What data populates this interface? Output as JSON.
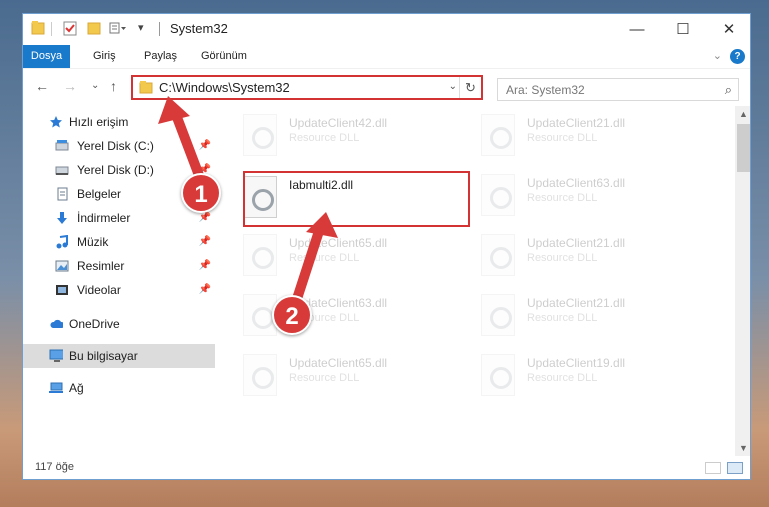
{
  "titlebar": {
    "title": "System32",
    "minimize_glyph": "—",
    "maximize_glyph": "☐",
    "close_glyph": "✕"
  },
  "ribbon": {
    "tabs": [
      {
        "label": "Dosya"
      },
      {
        "label": "Giriş"
      },
      {
        "label": "Paylaş"
      },
      {
        "label": "Görünüm"
      }
    ],
    "help_glyph": "?",
    "expand_glyph": "⌄"
  },
  "address": {
    "path": "C:\\Windows\\System32",
    "dropdown_glyph": "⌄",
    "refresh_glyph": "↻"
  },
  "search": {
    "placeholder": "Ara: System32"
  },
  "nav_buttons": {
    "back": "←",
    "forward": "→",
    "recent": "⌄",
    "up": "↑"
  },
  "navpane": {
    "items": [
      {
        "label": "Hızlı erişim",
        "icon": "star-icon"
      },
      {
        "label": "Yerel Disk (C:)",
        "icon": "drive-icon",
        "pinned": true
      },
      {
        "label": "Yerel Disk (D:)",
        "icon": "drive-icon",
        "pinned": true
      },
      {
        "label": "Belgeler",
        "icon": "documents-icon",
        "pinned": true
      },
      {
        "label": "İndirmeler",
        "icon": "downloads-icon",
        "pinned": true
      },
      {
        "label": "Müzik",
        "icon": "music-icon",
        "pinned": true
      },
      {
        "label": "Resimler",
        "icon": "pictures-icon",
        "pinned": true
      },
      {
        "label": "Videolar",
        "icon": "videos-icon",
        "pinned": true
      },
      {
        "label": "OneDrive",
        "icon": "cloud-icon"
      },
      {
        "label": "Bu bilgisayar",
        "icon": "computer-icon",
        "selected": true
      },
      {
        "label": "Ağ",
        "icon": "network-icon"
      }
    ],
    "pin_glyph": "📌"
  },
  "files": [
    {
      "name": "UpdateClient42.dll",
      "type": "Resource DLL"
    },
    {
      "name": "UpdateClient21.dll",
      "type": "Resource DLL"
    },
    {
      "name": "Iabmulti2.dll",
      "type": ""
    },
    {
      "name": "UpdateClient63.dll",
      "type": "Resource DLL"
    },
    {
      "name": "UpdateClient65.dll",
      "type": "Resource DLL"
    },
    {
      "name": "UpdateClient21.dll",
      "type": "Resource DLL"
    },
    {
      "name": "UpdateClient63.dll",
      "type": "Resource DLL"
    },
    {
      "name": "UpdateClient21.dll",
      "type": "Resource DLL"
    },
    {
      "name": "UpdateClient65.dll",
      "type": "Resource DLL"
    },
    {
      "name": "UpdateClient19.dll",
      "type": "Resource DLL"
    }
  ],
  "status": {
    "count": "117 öğe"
  },
  "annotations": {
    "step1": "1",
    "step2": "2"
  },
  "colors": {
    "accent": "#1979ca",
    "highlight": "#d33333",
    "callout": "#d83a3a"
  }
}
